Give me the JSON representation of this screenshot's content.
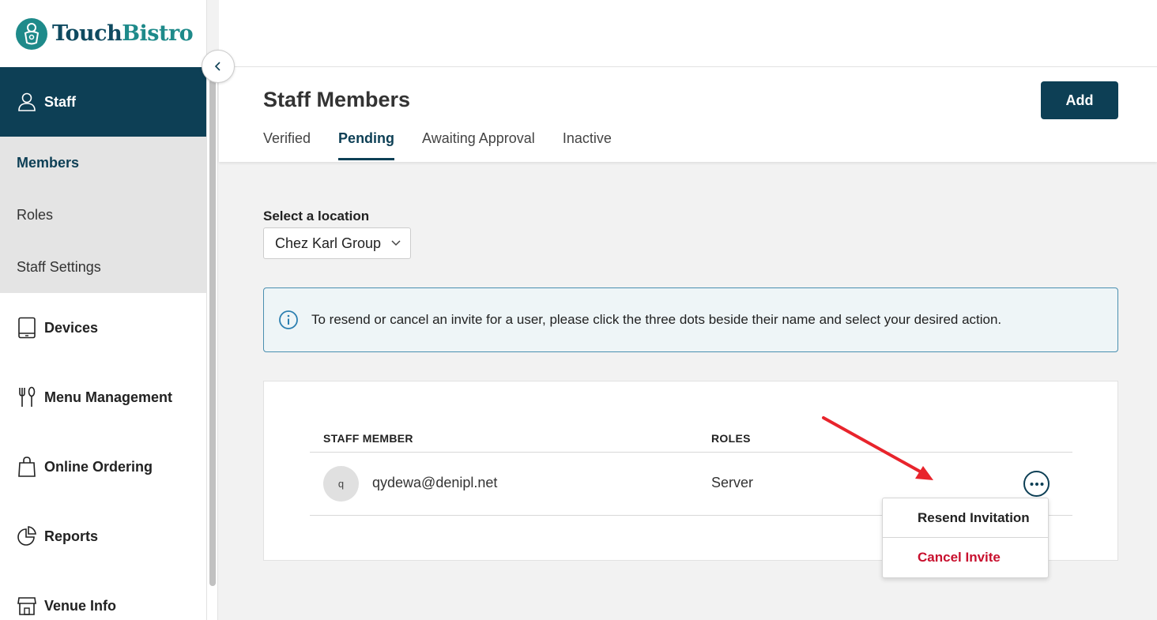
{
  "brand": {
    "name_part1": "Touch",
    "name_part2": "Bistro"
  },
  "sidebar": {
    "active_section": "Staff",
    "sub_items": [
      {
        "label": "Members"
      },
      {
        "label": "Roles"
      },
      {
        "label": "Staff Settings"
      }
    ],
    "items": [
      {
        "label": "Devices",
        "icon": "tablet-icon"
      },
      {
        "label": "Menu Management",
        "icon": "utensils-icon"
      },
      {
        "label": "Online Ordering",
        "icon": "shopping-bag-icon"
      },
      {
        "label": "Reports",
        "icon": "pie-chart-icon"
      },
      {
        "label": "Venue Info",
        "icon": "storefront-icon"
      }
    ]
  },
  "header": {
    "title": "Staff Members",
    "add_label": "Add",
    "tabs": [
      {
        "label": "Verified"
      },
      {
        "label": "Pending"
      },
      {
        "label": "Awaiting Approval"
      },
      {
        "label": "Inactive"
      }
    ]
  },
  "location": {
    "label": "Select a location",
    "selected": "Chez Karl Group"
  },
  "info_message": "To resend or cancel an invite for a user, please click the three dots beside their name and select your desired action.",
  "table": {
    "columns": [
      "STAFF MEMBER",
      "ROLES"
    ],
    "rows": [
      {
        "initial": "q",
        "email": "qydewa@denipl.net",
        "role": "Server"
      }
    ]
  },
  "actions_menu": {
    "resend": "Resend Invitation",
    "cancel": "Cancel Invite"
  },
  "colors": {
    "primary": "#0d3f55",
    "teal": "#1e8a8a",
    "danger": "#c8102e",
    "annotation": "#e8242c"
  }
}
